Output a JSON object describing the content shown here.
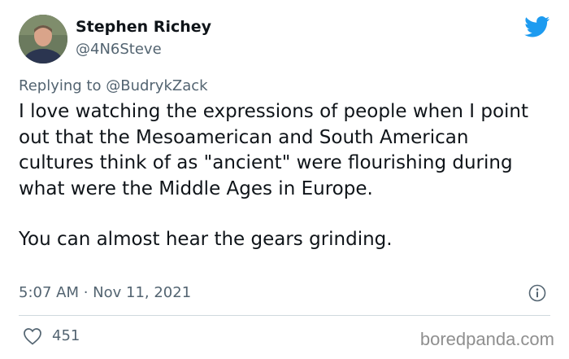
{
  "author": {
    "name": "Stephen Richey",
    "handle": "@4N6Steve"
  },
  "reply": {
    "prefix": "Replying to",
    "mention": "@BudrykZack"
  },
  "tweet": {
    "paragraph_1": "I love watching the expressions of people when I point out that the Mesoamerican and South American cultures think of as \"ancient\" were flourishing during what were the Middle Ages in Europe.",
    "paragraph_2": "You can almost hear the gears grinding.",
    "timestamp": "5:07 AM · Nov 11, 2021"
  },
  "actions": {
    "like_count": "451"
  },
  "watermark": "boredpanda.com",
  "colors": {
    "twitter_blue": "#1d9bf0",
    "secondary_text": "#536471",
    "divider": "#cfd9de"
  },
  "icons": {
    "bird": "twitter-bird-icon",
    "info": "info-icon",
    "like": "heart-icon"
  }
}
